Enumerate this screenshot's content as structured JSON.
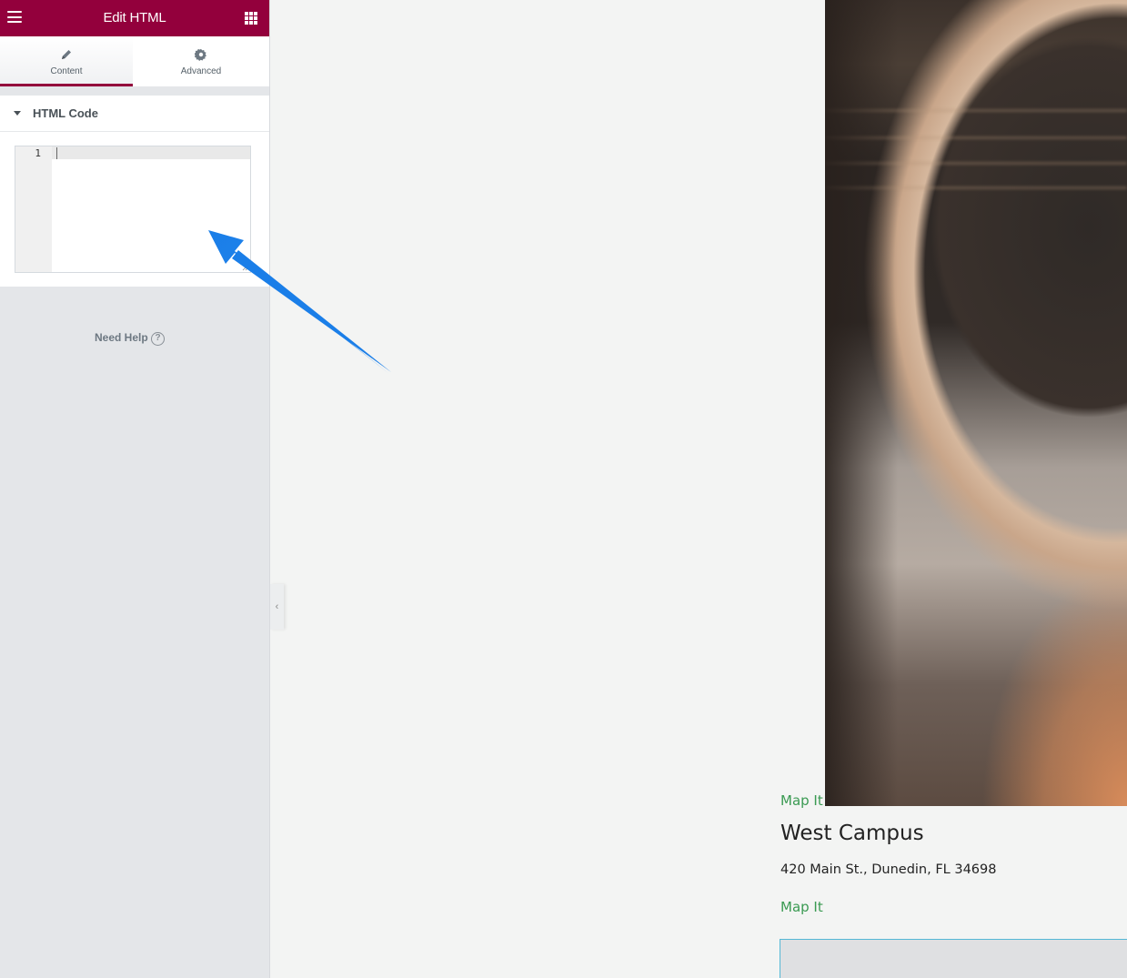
{
  "panel": {
    "title": "Edit HTML",
    "tabs": [
      {
        "label": "Content",
        "icon": "pencil-icon",
        "active": true
      },
      {
        "label": "Advanced",
        "icon": "gear-icon",
        "active": false
      }
    ],
    "section": {
      "title": "HTML Code",
      "icon": "caret-down-icon"
    },
    "code_editor": {
      "line_numbers": [
        "1"
      ],
      "value": ""
    },
    "need_help": "Need Help",
    "help_icon_glyph": "?",
    "collapse_glyph": "‹",
    "colors": {
      "brand": "#93003c",
      "panel_bg": "#e4e6e9"
    }
  },
  "preview": {
    "map_it_top": "Map It",
    "campus": {
      "name": "West Campus",
      "address": "420 Main St., Dunedin, FL 34698",
      "map_link": "Map It"
    },
    "link_color": "#3a9a52"
  },
  "annotation": {
    "type": "arrow",
    "color": "#1a7ee8"
  }
}
